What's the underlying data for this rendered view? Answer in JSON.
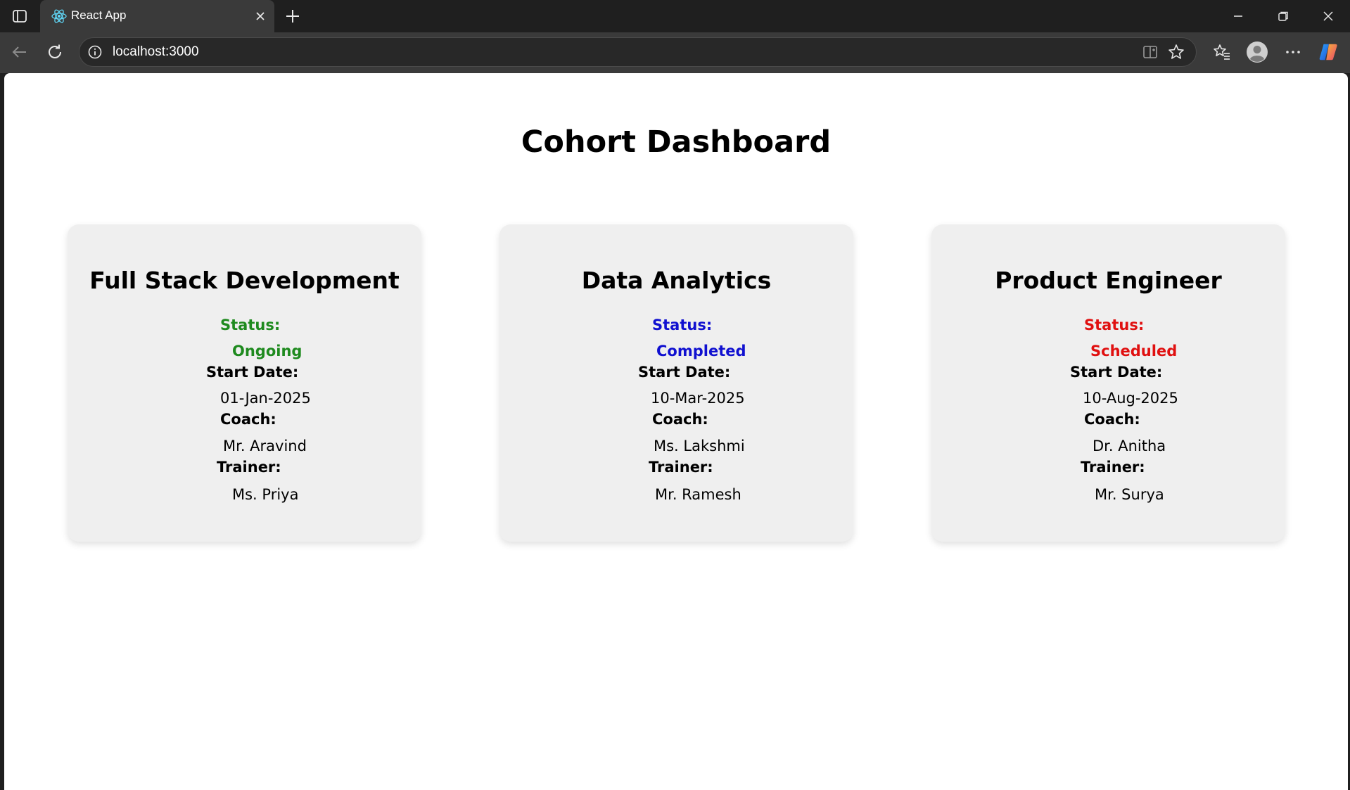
{
  "browser": {
    "tab_title": "React App",
    "url": "localhost:3000"
  },
  "page": {
    "title": "Cohort Dashboard"
  },
  "labels": {
    "status": "Status:",
    "start_date": "Start Date:",
    "coach": "Coach:",
    "trainer": "Trainer:"
  },
  "cohorts": [
    {
      "name": "Full Stack Development",
      "status": "Ongoing",
      "status_color": "#1e8a1e",
      "start_date": "01-Jan-2025",
      "coach": "Mr. Aravind",
      "trainer": "Ms. Priya"
    },
    {
      "name": "Data Analytics",
      "status": "Completed",
      "status_color": "#1010d0",
      "start_date": "10-Mar-2025",
      "coach": "Ms. Lakshmi",
      "trainer": "Mr. Ramesh"
    },
    {
      "name": "Product Engineer",
      "status": "Scheduled",
      "status_color": "#e01010",
      "start_date": "10-Aug-2025",
      "coach": "Dr. Anitha",
      "trainer": "Mr. Surya"
    }
  ],
  "icons": {
    "tab_actions": "tab-actions-icon",
    "favicon": "react-logo-icon",
    "close_tab": "close-icon",
    "new_tab": "plus-icon",
    "minimize": "minimize-icon",
    "restore": "restore-icon",
    "close_window": "close-icon",
    "back": "arrow-left-icon",
    "reload": "reload-icon",
    "site_info": "info-icon",
    "split_screen": "split-screen-icon",
    "favorite": "star-icon",
    "favorites": "favorites-icon",
    "profile": "avatar-icon",
    "more": "more-icon",
    "copilot": "copilot-icon"
  }
}
